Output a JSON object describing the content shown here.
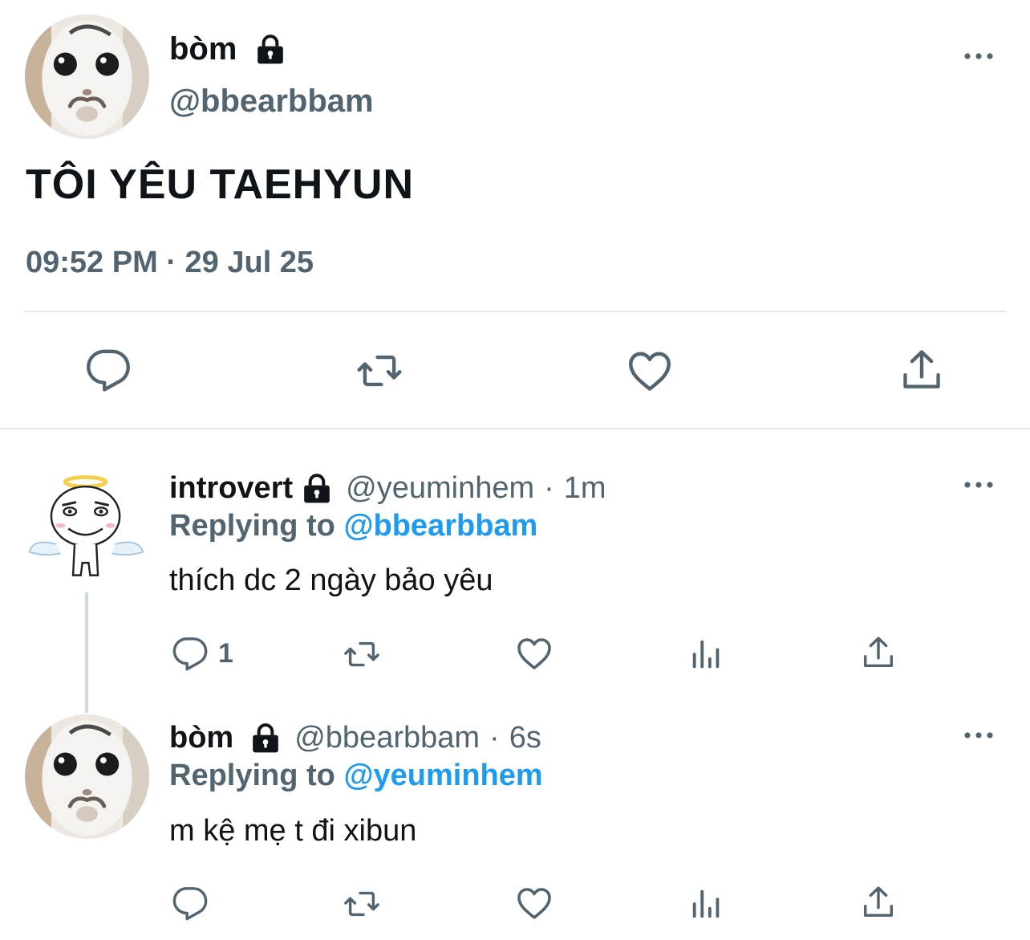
{
  "main_tweet": {
    "display_name": "bòm",
    "handle": "@bbearbbam",
    "text": "TÔI YÊU TAEHYUN",
    "timestamp": "09:52 PM · 29 Jul 25",
    "avatar_icon": "cat-avatar",
    "protected_icon": "lock-icon",
    "actions": [
      "reply",
      "retweet",
      "like",
      "share"
    ]
  },
  "replies": [
    {
      "display_name": "introvert",
      "handle": "@yeuminhem",
      "separator": "·",
      "time": "1m",
      "replying_prefix": "Replying to",
      "replying_to": "@bbearbbam",
      "text": "thích dc 2 ngày bảo yêu",
      "reply_count": "1",
      "avatar_icon": "angel-meme-avatar"
    },
    {
      "display_name": "bòm",
      "handle": "@bbearbbam",
      "separator": "·",
      "time": "6s",
      "replying_prefix": "Replying to",
      "replying_to": "@yeuminhem",
      "text": "m kệ mẹ t đi xibun",
      "reply_count": "",
      "avatar_icon": "cat-avatar"
    }
  ],
  "colors": {
    "text": "#0f1419",
    "muted": "#536471",
    "link": "#1d9bf0",
    "divider": "#e1e8ed"
  }
}
